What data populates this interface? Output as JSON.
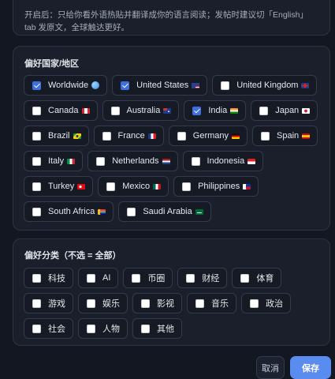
{
  "notice": "开启后：只给你看外语热贴并翻译成你的语言阅读；发帖时建议切「English」tab 发原文，全球触达更好。",
  "country_section": {
    "title": "偏好国家/地区",
    "items": [
      {
        "label": "Worldwide",
        "checked": true,
        "flag": "globe-icon"
      },
      {
        "label": "United States",
        "checked": true,
        "flag": "us-flag-icon"
      },
      {
        "label": "United Kingdom",
        "checked": false,
        "flag": "uk-flag-icon"
      },
      {
        "label": "Canada",
        "checked": false,
        "flag": "canada-flag-icon"
      },
      {
        "label": "Australia",
        "checked": false,
        "flag": "australia-flag-icon"
      },
      {
        "label": "India",
        "checked": true,
        "flag": "india-flag-icon"
      },
      {
        "label": "Japan",
        "checked": false,
        "flag": "japan-flag-icon"
      },
      {
        "label": "Brazil",
        "checked": false,
        "flag": "brazil-flag-icon"
      },
      {
        "label": "France",
        "checked": false,
        "flag": "france-flag-icon"
      },
      {
        "label": "Germany",
        "checked": false,
        "flag": "germany-flag-icon"
      },
      {
        "label": "Spain",
        "checked": false,
        "flag": "spain-flag-icon"
      },
      {
        "label": "Italy",
        "checked": false,
        "flag": "italy-flag-icon"
      },
      {
        "label": "Netherlands",
        "checked": false,
        "flag": "netherlands-flag-icon"
      },
      {
        "label": "Indonesia",
        "checked": false,
        "flag": "indonesia-flag-icon"
      },
      {
        "label": "Turkey",
        "checked": false,
        "flag": "turkey-flag-icon"
      },
      {
        "label": "Mexico",
        "checked": false,
        "flag": "mexico-flag-icon"
      },
      {
        "label": "Philippines",
        "checked": false,
        "flag": "philippines-flag-icon"
      },
      {
        "label": "South Africa",
        "checked": false,
        "flag": "south-africa-flag-icon"
      },
      {
        "label": "Saudi Arabia",
        "checked": false,
        "flag": "saudi-arabia-flag-icon"
      }
    ]
  },
  "category_section": {
    "title": "偏好分类（不选 = 全部）",
    "items": [
      {
        "label": "科技",
        "checked": false
      },
      {
        "label": "AI",
        "checked": false
      },
      {
        "label": "币圈",
        "checked": false
      },
      {
        "label": "财经",
        "checked": false
      },
      {
        "label": "体育",
        "checked": false
      },
      {
        "label": "游戏",
        "checked": false
      },
      {
        "label": "娱乐",
        "checked": false
      },
      {
        "label": "影视",
        "checked": false
      },
      {
        "label": "音乐",
        "checked": false
      },
      {
        "label": "政治",
        "checked": false
      },
      {
        "label": "社会",
        "checked": false
      },
      {
        "label": "人物",
        "checked": false
      },
      {
        "label": "其他",
        "checked": false
      }
    ]
  },
  "footer": {
    "cancel_label": "取消",
    "save_label": "保存"
  },
  "colors": {
    "accent": "#5a8cf0",
    "checkbox_checked": "#3d6fe0",
    "background": "#131722",
    "card": "#1a1f2b"
  }
}
